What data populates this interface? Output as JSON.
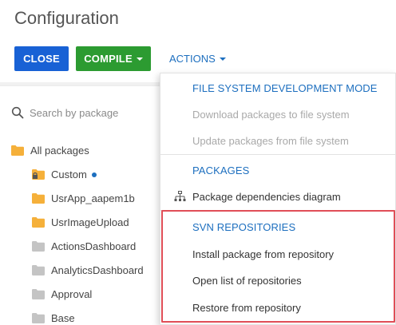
{
  "page": {
    "title": "Configuration"
  },
  "toolbar": {
    "close_label": "CLOSE",
    "compile_label": "COMPILE",
    "actions_label": "ACTIONS"
  },
  "search": {
    "placeholder": "Search by package"
  },
  "tree": {
    "root_label": "All packages",
    "items": [
      {
        "label": "Custom",
        "type": "locked-orange",
        "has_dot": true
      },
      {
        "label": "UsrApp_aapem1b",
        "type": "orange"
      },
      {
        "label": "UsrImageUpload",
        "type": "orange"
      },
      {
        "label": "ActionsDashboard",
        "type": "gray"
      },
      {
        "label": "AnalyticsDashboard",
        "type": "gray"
      },
      {
        "label": "Approval",
        "type": "gray"
      },
      {
        "label": "Base",
        "type": "gray"
      }
    ]
  },
  "actions_menu": {
    "fs_header": "FILE SYSTEM DEVELOPMENT MODE",
    "download_fs": "Download packages to file system",
    "update_fs": "Update packages from file system",
    "packages_header": "PACKAGES",
    "dependencies": "Package dependencies diagram",
    "svn_header": "SVN REPOSITORIES",
    "install_repo": "Install package from repository",
    "open_list": "Open list of repositories",
    "restore_repo": "Restore from repository"
  },
  "colors": {
    "primary_blue": "#1861d5",
    "compile_green": "#2c9b31",
    "link_blue": "#1d6fbf",
    "folder_orange": "#f5b03a",
    "folder_gray": "#c4c4c4",
    "highlight_red": "#e04e57"
  }
}
